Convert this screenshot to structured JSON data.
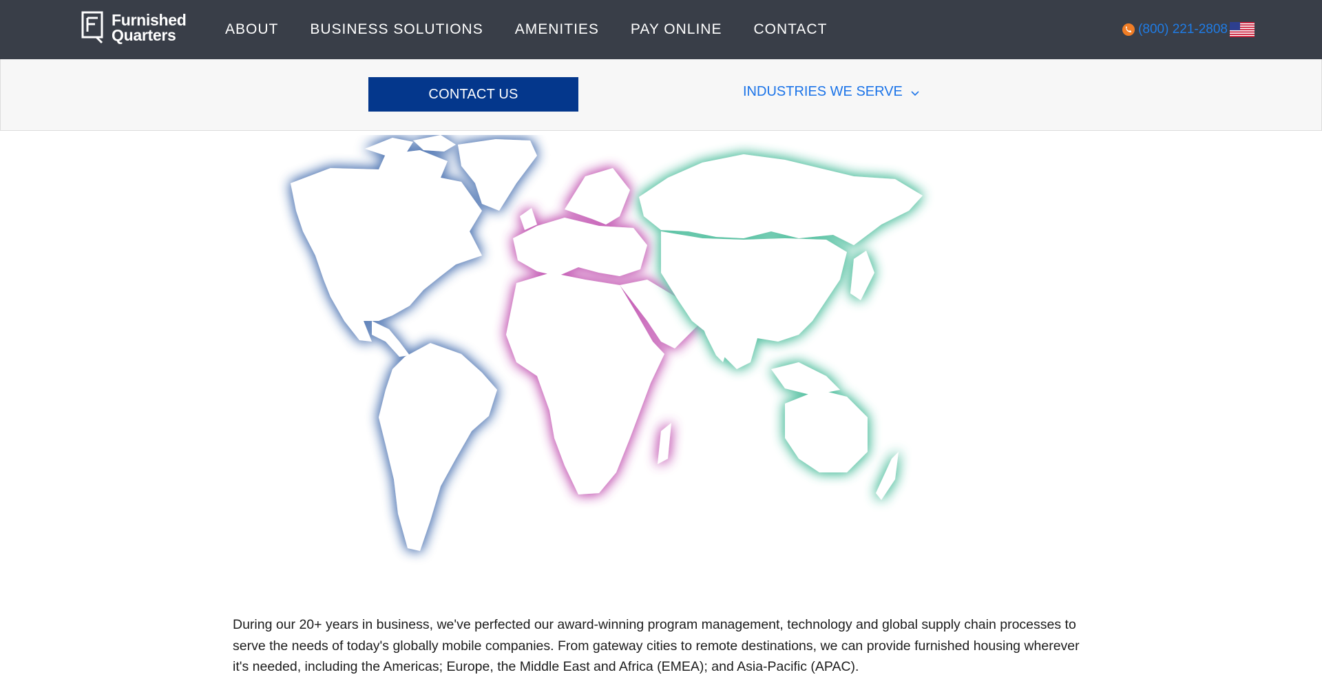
{
  "header": {
    "logo": {
      "line1": "Furnished",
      "line2": "Quarters"
    },
    "nav": [
      {
        "label": "ABOUT"
      },
      {
        "label": "BUSINESS SOLUTIONS"
      },
      {
        "label": "AMENITIES"
      },
      {
        "label": "PAY ONLINE"
      },
      {
        "label": "CONTACT"
      }
    ],
    "phone": "(800) 221-2808",
    "icons": {
      "phone": "phone-icon",
      "flag": "us-flag-icon"
    }
  },
  "subnav": {
    "contact_button": "CONTACT US",
    "industries_label": "INDUSTRIES WE SERVE",
    "industries_icon": "chevron-down-icon"
  },
  "map": {
    "regions": [
      {
        "name": "Americas",
        "glow_color": "#5b7fb8"
      },
      {
        "name": "EMEA",
        "glow_color": "#c763b8"
      },
      {
        "name": "APAC",
        "glow_color": "#5cc3a5"
      }
    ]
  },
  "content": {
    "description": "During our 20+ years in business, we've perfected our award-winning program management, technology and global supply chain processes to serve the needs of today's globally mobile companies. From gateway cities to remote destinations, we can provide furnished housing wherever it's needed, including the Americas; Europe, the Middle East and Africa (EMEA); and Asia-Pacific (APAC)."
  },
  "colors": {
    "topbar": "#393e48",
    "button": "#04378c",
    "link": "#1a73e8"
  }
}
